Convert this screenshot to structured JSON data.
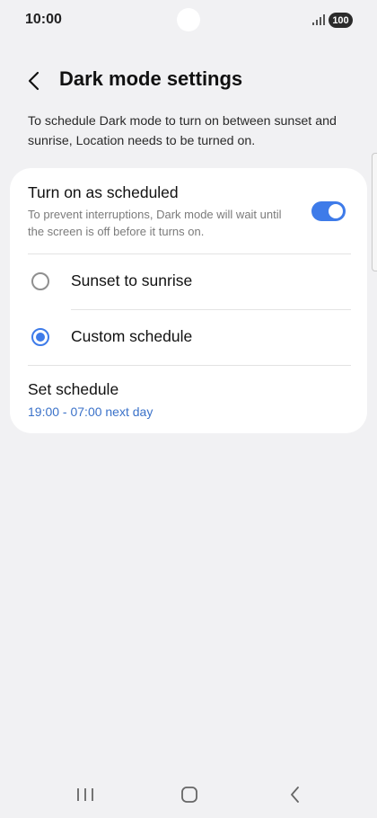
{
  "status": {
    "time": "10:00",
    "battery": "100",
    "icons": [
      "camera-cutout",
      "signal-icon",
      "battery-icon"
    ]
  },
  "header": {
    "title": "Dark mode settings",
    "back_icon": "chevron-left-icon"
  },
  "intro_text": "To schedule Dark mode to turn on between sunset and sunrise, Location needs to be turned on.",
  "schedule": {
    "title": "Turn on as scheduled",
    "description": "To prevent interruptions, Dark mode will wait until the screen is off before it turns on.",
    "enabled": true
  },
  "options": [
    {
      "label": "Sunset to sunrise",
      "selected": false
    },
    {
      "label": "Custom schedule",
      "selected": true
    }
  ],
  "set_schedule": {
    "title": "Set schedule",
    "value": "19:00 - 07:00 next day"
  },
  "colors": {
    "accent": "#3e7be9",
    "link": "#3b72c9",
    "background": "#f1f1f3",
    "card": "#ffffff"
  },
  "nav": {
    "icons": [
      "recent-apps-icon",
      "home-icon",
      "back-icon"
    ]
  }
}
